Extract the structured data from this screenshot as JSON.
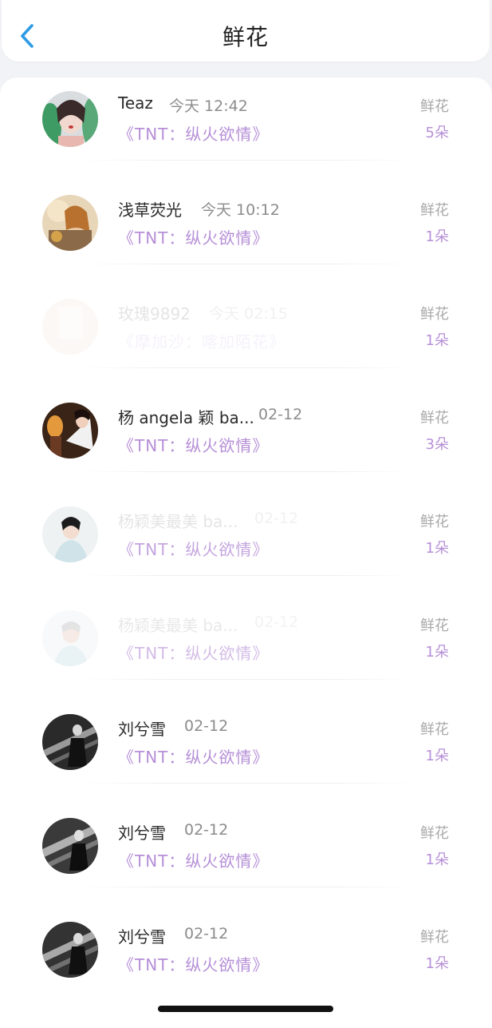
{
  "header": {
    "title": "鲜花",
    "back_icon": "chevron-left-icon",
    "accent": "#2e9be6"
  },
  "colors": {
    "song": "#b68fd7",
    "count": "#b68fd7",
    "label": "#a9a9a9"
  },
  "items": [
    {
      "name": "Teaz",
      "time": "今天 12:42",
      "song": "《TNT：纵火欲情》",
      "gift": "鲜花",
      "count": "5朵"
    },
    {
      "name": "浅草荧光",
      "time": "今天 10:12",
      "song": "《TNT：纵火欲情》",
      "gift": "鲜花",
      "count": "1朵"
    },
    {
      "name": "玫瑰9892",
      "time": "今天 02:15",
      "song": "《摩加沙：喀加陌花》",
      "gift": "鲜花",
      "count": "1朵"
    },
    {
      "name": "杨 angela 颖 ba...",
      "time": "02-12",
      "song": "《TNT：纵火欲情》",
      "gift": "鲜花",
      "count": "3朵"
    },
    {
      "name": "杨颖美最美 ba...",
      "time": "02-12",
      "song": "《TNT：纵火欲情》",
      "gift": "鲜花",
      "count": "1朵"
    },
    {
      "name": "杨颖美最美 ba...",
      "time": "02-12",
      "song": "《TNT：纵火欲情》",
      "gift": "鲜花",
      "count": "1朵"
    },
    {
      "name": "刘兮雪",
      "time": "02-12",
      "song": "《TNT：纵火欲情》",
      "gift": "鲜花",
      "count": "1朵"
    },
    {
      "name": "刘兮雪",
      "time": "02-12",
      "song": "《TNT：纵火欲情》",
      "gift": "鲜花",
      "count": "1朵"
    },
    {
      "name": "刘兮雪",
      "time": "02-12",
      "song": "《TNT：纵火欲情》",
      "gift": "鲜花",
      "count": "1朵"
    }
  ]
}
